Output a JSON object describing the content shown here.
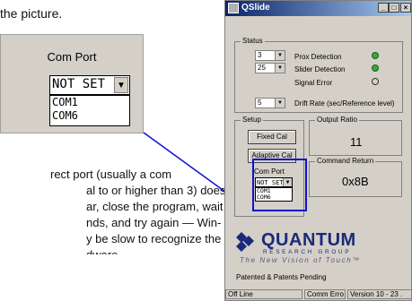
{
  "doc": {
    "top_line": "the picture.",
    "lines": [
      "rect port (usually a com",
      "al to or higher than 3) does",
      "ar, close the program, wait",
      "nds, and try again — Win-",
      "y be slow to recognize the",
      "dware."
    ]
  },
  "zoom": {
    "label": "Com Port",
    "selected": "NOT SET",
    "options": [
      "COM1",
      "COM6"
    ]
  },
  "window": {
    "title": "QSlide",
    "buttons": {
      "min": "_",
      "max": "□",
      "close": "×"
    },
    "status_group": {
      "title": "Status",
      "spin1": "3",
      "spin2": "25",
      "spin3": "5",
      "prox_label": "Prox Detection",
      "slider_label": "Slider Detection",
      "signal_label": "Signal Error",
      "drift_label": "Drift Rate (sec/Reference level)"
    },
    "setup_group": {
      "title": "Setup",
      "fixed_cal": "Fixed Cal",
      "adaptive_cal": "Adaptive Cal",
      "com_port_label": "Com Port",
      "selected": "NOT SET",
      "options": [
        "COM1",
        "COM6"
      ]
    },
    "output_ratio": {
      "title": "Output Ratio",
      "value": "11"
    },
    "command_return": {
      "title": "Command Return",
      "value": "0x8B"
    },
    "logo": {
      "word": "QUANTUM",
      "sub": "RESEARCH GROUP",
      "tagline": "The New Vision of Touch™"
    },
    "patent": "Patented & Patents Pending",
    "status_bar": {
      "line": "Off Line",
      "error": "Comm Erro",
      "version": "Version  10 - 23 ."
    }
  },
  "colors": {
    "led_green": "#3aa83a",
    "highlight": "#1010d0",
    "title_blue": "#0a246a"
  }
}
